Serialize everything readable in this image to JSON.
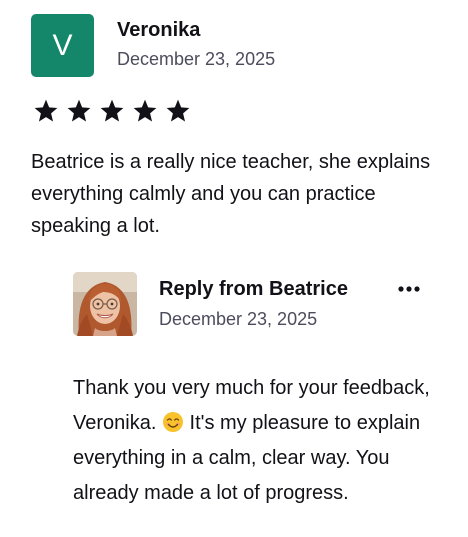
{
  "review": {
    "author_initial": "V",
    "author_name": "Veronika",
    "date": "December 23, 2025",
    "rating": 5,
    "text": "Beatrice is a really nice teacher, she explains everything calmly and you can practice speaking a lot."
  },
  "reply": {
    "title": "Reply from Beatrice",
    "date": "December 23, 2025",
    "text_before_emoji": "Thank you very much for your feedback, Veronika. ",
    "emoji": "smiling-face-icon",
    "text_after_emoji": " It's my pleasure to explain everything in a calm, clear way. You already made a lot of progress.",
    "more_icon": "more-dots-icon"
  },
  "colors": {
    "avatar_bg": "#14876b",
    "text": "#121117",
    "muted": "#4d4c5c"
  }
}
